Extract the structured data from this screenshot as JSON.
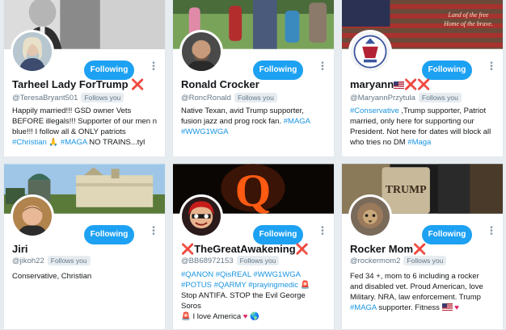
{
  "follow_label": "Following",
  "follows_you_label": "Follows you",
  "cards": [
    {
      "name": "Tarheel Lady ForTrump",
      "name_suffix": "❌",
      "handle": "@TeresaBryant501",
      "bio": [
        "Happily married!!! GSD owner Vets",
        "BEFORE illegals!!! Supporter of our men n",
        "blue!!! I follow all & ONLY patriots"
      ],
      "bio_last_plain": " NO TRAINS...tyl",
      "tags_last": [
        "#Christian",
        "#MAGA"
      ]
    },
    {
      "name": "Ronald Crocker",
      "handle": "@RoncRonald",
      "bio": [
        "Native Texan, avid Trump supporter,",
        "fusion jazz and prog rock fan."
      ],
      "tags": [
        "#MAGA",
        "#WWG1WGA"
      ]
    },
    {
      "name": "maryann",
      "name_suffix": "❌❌",
      "handle": "@MaryannPrzytula",
      "tag_first": "#Conservative",
      "bio": [
        " ,Trump supporter, Patriot",
        "married, only here for supporting our",
        "President. Not here for dates will block all",
        "who tries no DM "
      ],
      "tag_last": "#Maga",
      "banner_text": [
        "Land of the free",
        "Home of the brave."
      ]
    },
    {
      "name": "Jiri",
      "handle": "@jikoh22",
      "bio": [
        "Conservative, Christian"
      ]
    },
    {
      "name_prefix": "❌",
      "name": "TheGreatAwakening",
      "name_suffix": "❌",
      "handle": "@BB68972153",
      "tags_line1": [
        "#QANON",
        "#QisREAL",
        "#WWG1WGA"
      ],
      "tags_line2": [
        "#POTUS",
        "#QARMY",
        "#prayingmedic"
      ],
      "bio_line3": "Stop ANTIFA. STOP the Evil George Soros",
      "bio_line4": "I love America",
      "banner_letter": "Q"
    },
    {
      "name": "Rocker Mom",
      "name_suffix": "❌",
      "handle": "@rockermom2",
      "bio": [
        "Fed 34 +, mom to 6 including a rocker",
        "and disabled vet. Proud American, love",
        "Military. NRA, law enforcement. Trump"
      ],
      "tag_last": "#MAGA",
      "bio_last_plain": " supporter. Fitness",
      "banner_text": "TRUMP"
    }
  ]
}
